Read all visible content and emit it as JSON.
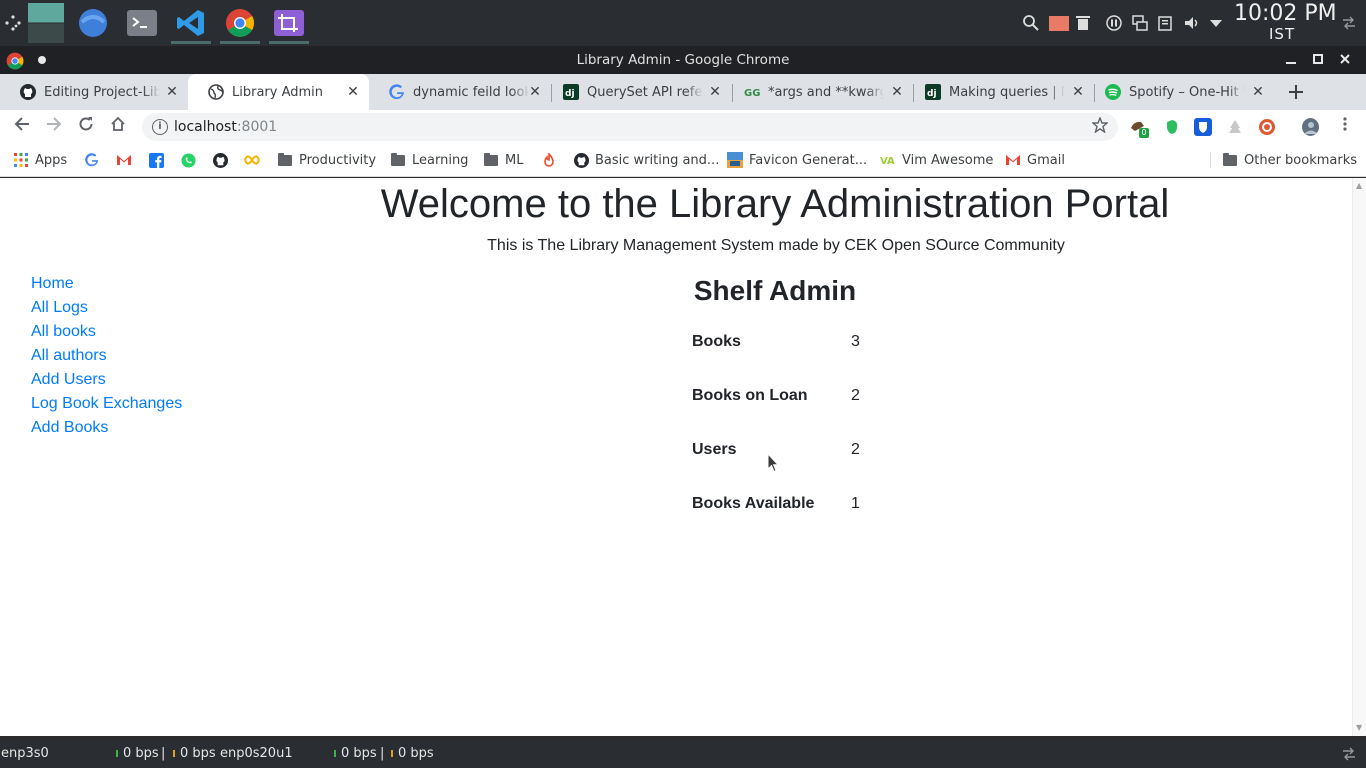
{
  "taskbar": {
    "apps": [
      {
        "name": "desktop-grid"
      },
      {
        "name": "file-manager"
      },
      {
        "name": "terminal"
      },
      {
        "name": "vscode"
      },
      {
        "name": "chrome"
      },
      {
        "name": "screenshot-tool"
      }
    ],
    "clock_time": "10:02 PM",
    "clock_tz": "IST"
  },
  "window": {
    "title": "Library Admin - Google Chrome"
  },
  "tabs": [
    {
      "title": "Editing Project-Library",
      "icon": "github-icon",
      "active": false
    },
    {
      "title": "Library Admin",
      "icon": "globe-icon",
      "active": true
    },
    {
      "title": "dynamic feild lookup",
      "icon": "google-icon",
      "active": false
    },
    {
      "title": "QuerySet API reference",
      "icon": "django-icon",
      "active": false
    },
    {
      "title": "*args and **kwargs",
      "icon": "geeks-icon",
      "active": false
    },
    {
      "title": "Making queries | Django",
      "icon": "django-icon",
      "active": false
    },
    {
      "title": "Spotify – One-Hit Wonders",
      "icon": "spotify-icon",
      "active": false
    }
  ],
  "toolbar": {
    "url_host": "localhost",
    "url_port": ":8001",
    "badge_count": "0"
  },
  "bookmarks": {
    "apps_label": "Apps",
    "items": [
      {
        "label": "Productivity",
        "icon": "folder-icon"
      },
      {
        "label": "Learning",
        "icon": "folder-icon"
      },
      {
        "label": "ML",
        "icon": "folder-icon"
      },
      {
        "label": "Basic writing and...",
        "icon": "github-icon"
      },
      {
        "label": "Favicon Generat...",
        "icon": "favicon-icon"
      },
      {
        "label": "Vim Awesome",
        "icon": "va-icon"
      },
      {
        "label": "Gmail",
        "icon": "gmail-icon"
      }
    ],
    "other": "Other bookmarks"
  },
  "page": {
    "heading": "Welcome to the Library Administration Portal",
    "subtitle": "This is The Library Management System made by CEK Open SOurce Community",
    "sidebar": [
      "Home",
      "All Logs",
      "All books",
      "All authors",
      "Add Users",
      "Log Book Exchanges",
      "Add Books"
    ],
    "shelf_title": "Shelf Admin",
    "stats": [
      {
        "label": "Books",
        "value": "3"
      },
      {
        "label": "Books on Loan",
        "value": "2"
      },
      {
        "label": "Users",
        "value": "2"
      },
      {
        "label": "Books Available",
        "value": "1"
      }
    ]
  },
  "statusbar": {
    "iface1": "enp3s0",
    "iface1_down": "0 bps",
    "iface1_up": "0 bps",
    "iface2": "enp0s20u1",
    "iface2_down": "0 bps",
    "iface2_up": "0 bps",
    "separator": "|"
  },
  "colors": {
    "link": "#007bff",
    "text": "#212529",
    "taskbar": "#2a2d31",
    "chrome_frame": "#202124",
    "tabstrip": "#dee1e6"
  }
}
